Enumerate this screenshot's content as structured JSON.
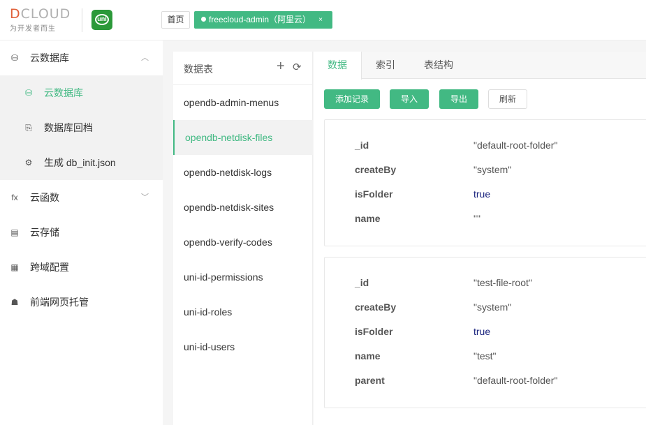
{
  "header": {
    "logo_word_x": "D",
    "logo_word_rest": "CLOUD",
    "logo_subtitle": "为开发者而生",
    "uni_logo_text": "uni",
    "tabs": [
      {
        "label": "首页"
      },
      {
        "label": "freecloud-admin（阿里云）",
        "close": "×"
      }
    ]
  },
  "sidebar": {
    "items": [
      {
        "label": "云数据库",
        "icon": "cloud-database-icon",
        "glyph": "⛁",
        "arrow": "︿",
        "expanded": true,
        "children": [
          {
            "label": "云数据库",
            "icon": "cloud-database-icon",
            "glyph": "⛁",
            "active": true
          },
          {
            "label": "数据库回档",
            "icon": "rollback-icon",
            "glyph": "⎘"
          },
          {
            "label": "生成 db_init.json",
            "icon": "generate-icon",
            "glyph": "⚙"
          }
        ]
      },
      {
        "label": "云函数",
        "icon": "function-icon",
        "glyph": "fx",
        "arrow": "﹀"
      },
      {
        "label": "云存储",
        "icon": "storage-icon",
        "glyph": "▤"
      },
      {
        "label": "跨域配置",
        "icon": "cors-icon",
        "glyph": "▦"
      },
      {
        "label": "前端网页托管",
        "icon": "hosting-icon",
        "glyph": "☗"
      }
    ]
  },
  "tables": {
    "title": "数据表",
    "add_glyph": "+",
    "refresh_glyph": "⟳",
    "items": [
      "opendb-admin-menus",
      "opendb-netdisk-files",
      "opendb-netdisk-logs",
      "opendb-netdisk-sites",
      "opendb-verify-codes",
      "uni-id-permissions",
      "uni-id-roles",
      "uni-id-users"
    ],
    "active_index": 1
  },
  "main": {
    "tabs": [
      "数据",
      "索引",
      "表结构"
    ],
    "active_tab": 0,
    "buttons": {
      "add": "添加记录",
      "import": "导入",
      "export": "导出",
      "refresh": "刷新"
    },
    "records": [
      {
        "rows": [
          {
            "key": "_id",
            "value": "\"default-root-folder\""
          },
          {
            "key": "createBy",
            "value": "\"system\""
          },
          {
            "key": "isFolder",
            "value": "true"
          },
          {
            "key": "name",
            "value": "\"\""
          }
        ]
      },
      {
        "rows": [
          {
            "key": "_id",
            "value": "\"test-file-root\""
          },
          {
            "key": "createBy",
            "value": "\"system\""
          },
          {
            "key": "isFolder",
            "value": "true"
          },
          {
            "key": "name",
            "value": "\"test\""
          },
          {
            "key": "parent",
            "value": "\"default-root-folder\""
          }
        ]
      }
    ]
  },
  "colors": {
    "accent": "#42b983",
    "boolean": "#1a237e"
  }
}
